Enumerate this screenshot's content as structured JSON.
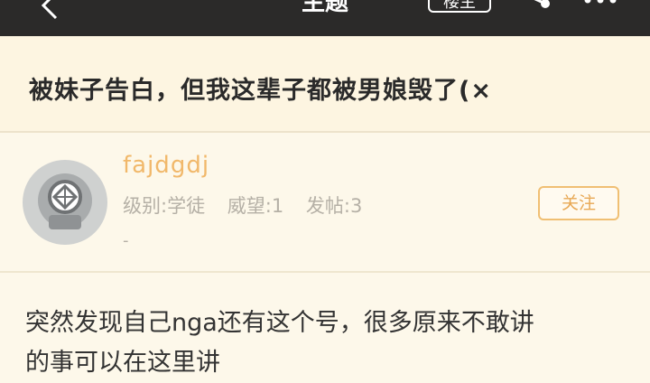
{
  "topbar": {
    "title": "主题",
    "op_badge": "楼主",
    "back_icon": "chevron-left-icon",
    "share_icon": "share-icon",
    "more_icon": "more-dots-icon"
  },
  "post": {
    "title": "被妹子告白，但我这辈子都被男娘毁了(×",
    "body_line1": "突然发现自己nga还有这个号，很多原来不敢讲",
    "body_line2": "的事可以在这里讲"
  },
  "user": {
    "name": "fajdgdj",
    "level": "级别:学徒",
    "prestige": "威望:1",
    "posts": "发帖:3",
    "extra": "-",
    "follow_label": "关注"
  },
  "colors": {
    "header_bg": "#2b2a29",
    "accent": "#f1b86a",
    "background": "#fdf8ea"
  }
}
